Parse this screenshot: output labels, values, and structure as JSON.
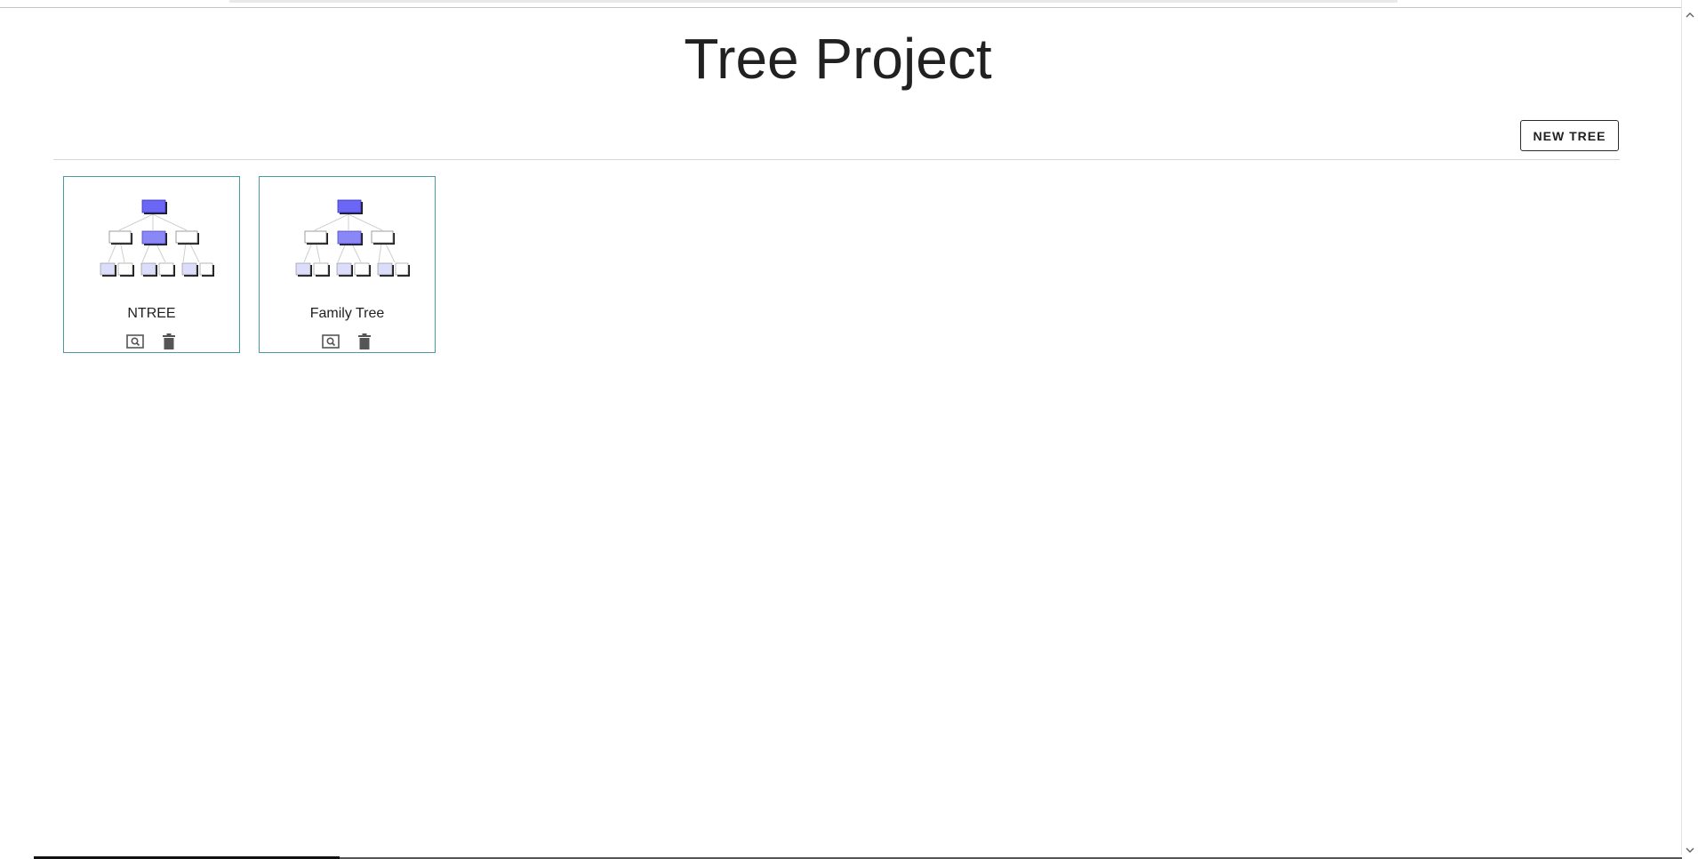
{
  "app": {
    "title": "Tree Project"
  },
  "toolbar": {
    "new_tree_label": "NEW TREE"
  },
  "trees": [
    {
      "name": "NTREE",
      "view_icon": "view-search-icon",
      "delete_icon": "trash-icon"
    },
    {
      "name": "Family Tree",
      "view_icon": "view-search-icon",
      "delete_icon": "trash-icon"
    }
  ],
  "colors": {
    "card_border": "#4a9aa6",
    "node_dark": "#6b66f5",
    "node_mid": "#8a87f7",
    "node_light": "#dcdcfb",
    "icon_gray": "#555555"
  }
}
